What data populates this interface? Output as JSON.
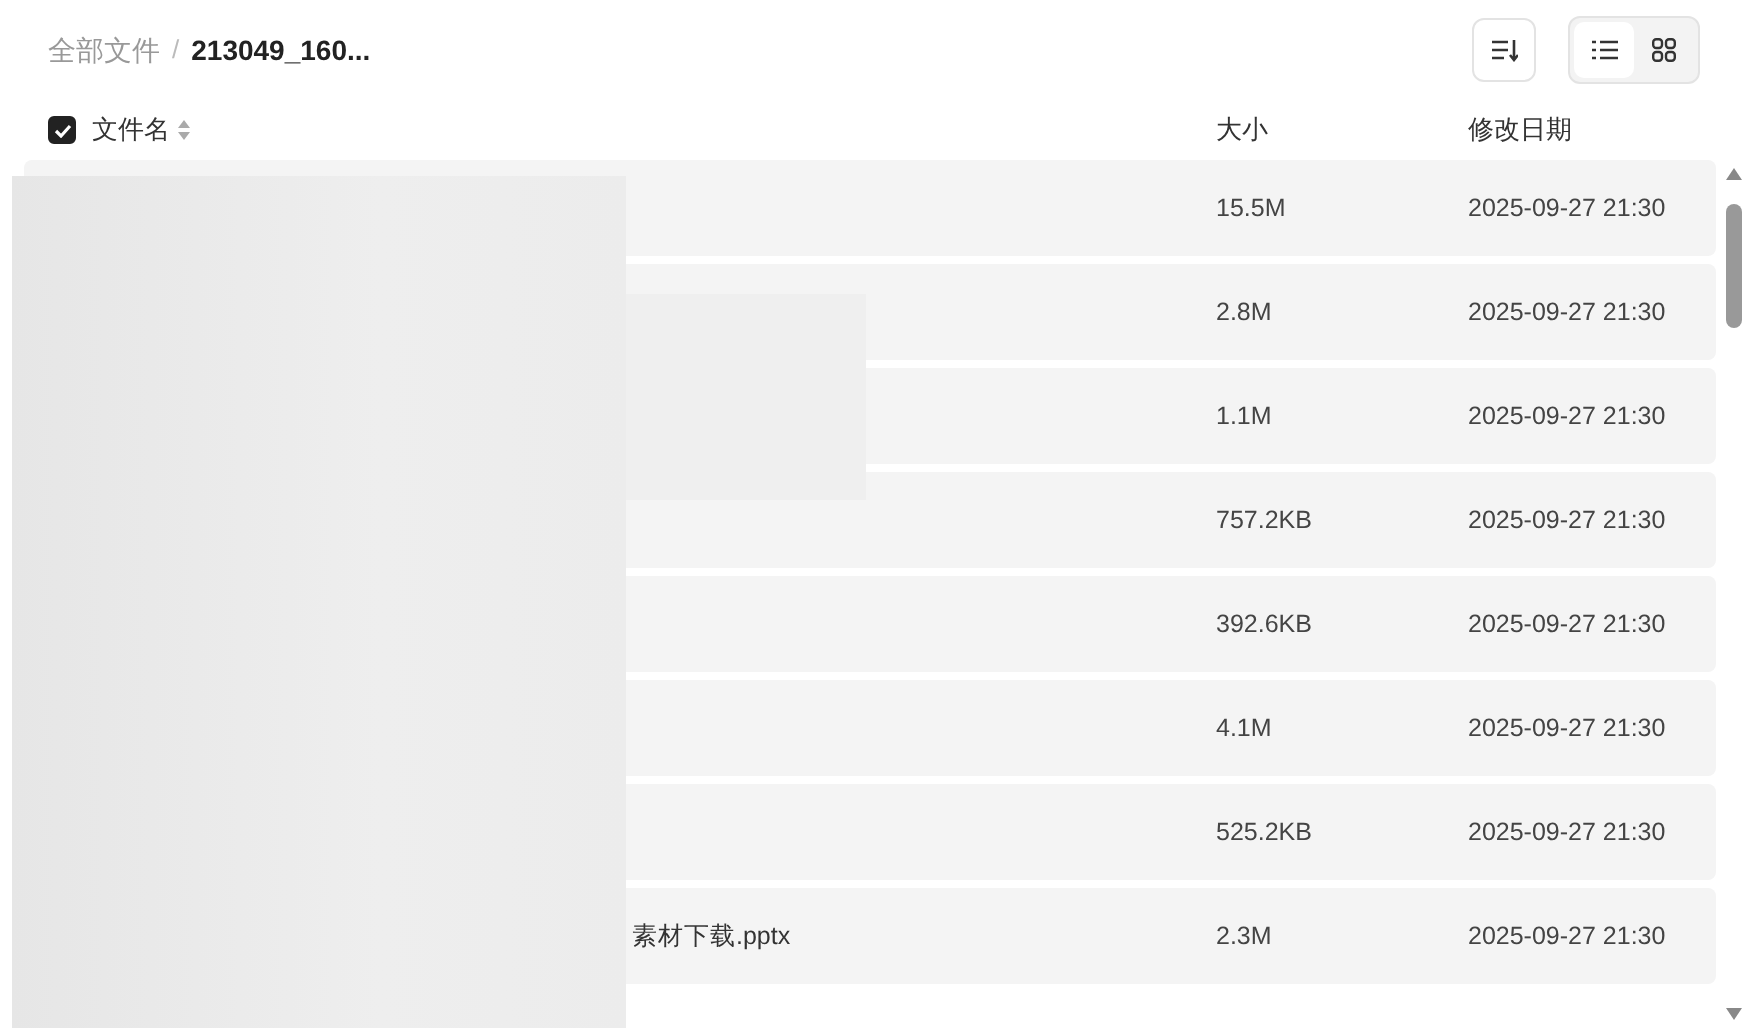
{
  "breadcrumb_separator": "/",
  "breadcrumb": [
    {
      "label": "全部文件",
      "current": false
    },
    {
      "label": "213049_160...",
      "current": true
    }
  ],
  "view_modes": [
    {
      "kind": "list",
      "selected": true
    },
    {
      "kind": "grid",
      "selected": false
    }
  ],
  "table": {
    "select_all": {
      "checked": true
    },
    "columns": [
      "文件名",
      "大小",
      "修改日期"
    ],
    "rows": [
      {
        "size": "15.5M",
        "date": "2025-09-27 21:30"
      },
      {
        "size": "2.8M",
        "date": "2025-09-27 21:30"
      },
      {
        "size": "1.1M",
        "date": "2025-09-27 21:30"
      },
      {
        "size": "757.2KB",
        "date": "2025-09-27 21:30"
      },
      {
        "size": "392.6KB",
        "date": "2025-09-27 21:30"
      },
      {
        "size": "4.1M",
        "date": "2025-09-27 21:30"
      },
      {
        "size": "525.2KB",
        "date": "2025-09-27 21:30"
      },
      {
        "name": "素材下载.pptx",
        "size": "2.3M",
        "date": "2025-09-27 21:30"
      }
    ]
  }
}
